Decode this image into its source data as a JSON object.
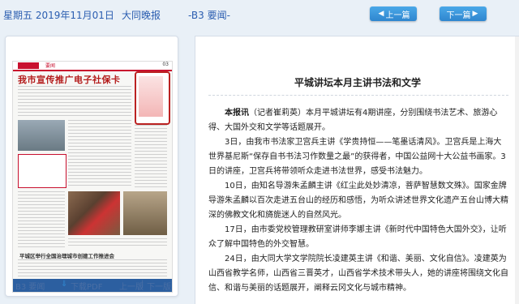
{
  "header": {
    "date": "星期五 2019年11月01日",
    "paper": "大同晚报",
    "section": "-B3 要闻-",
    "prev_label": "上一篇",
    "next_label": "下一篇"
  },
  "thumbnail": {
    "section_tag": "要闻",
    "page_no": "03",
    "headline": "我市宣传推广电子社保卡",
    "sub_headline": "平城区举行全国治理城市创建工作推进会"
  },
  "left_footer": {
    "page_label": "B3 要闻",
    "download_label": "下载PDF",
    "prev_page": "上一版",
    "separator": "|",
    "next_page": "下一版"
  },
  "article": {
    "title": "平城讲坛本月主讲书法和文学",
    "lead_label": "本报讯",
    "paragraphs": [
      "（记者崔莉英）本月平城讲坛有4期讲座，分别围绕书法艺术、旅游心得、大国外交和文学等话题展开。",
      "3日，由我市书法家卫宫兵主讲《学贵持恒——笔墨话清风》。卫宫兵是上海大世界基尼斯“保存自书书法习作数量之最”的获得者，中国公益网十大公益书画家。3日的讲座，卫宫兵将带领听众走进书法世界，感受书法魅力。",
      "10日，由知名导游朱孟麟主讲《红尘此处妙清凉，菩萨智慧数文殊》。国家金牌导游朱孟麟以百次走进五台山的经历和感悟，为听众讲述世界文化遗产五台山博大精深的佛教文化和旖旎迷人的自然风光。",
      "17日，由市委党校管理教研室讲师李娜主讲《新时代中国特色大国外交》，让听众了解中国特色的外交智慧。",
      "24日，由大同大学文学院院长凌建英主讲《和谐、美丽、文化自信》。凌建英为山西省教学名师，山西省三晋英才，山西省学术技术带头人，她的讲座将围绕文化自信、和谐与美丽的话题展开，阐释云冈文化与城市精神。"
    ]
  },
  "colors": {
    "accent_blue": "#2f86cf",
    "headline_red": "#b31b1b"
  }
}
